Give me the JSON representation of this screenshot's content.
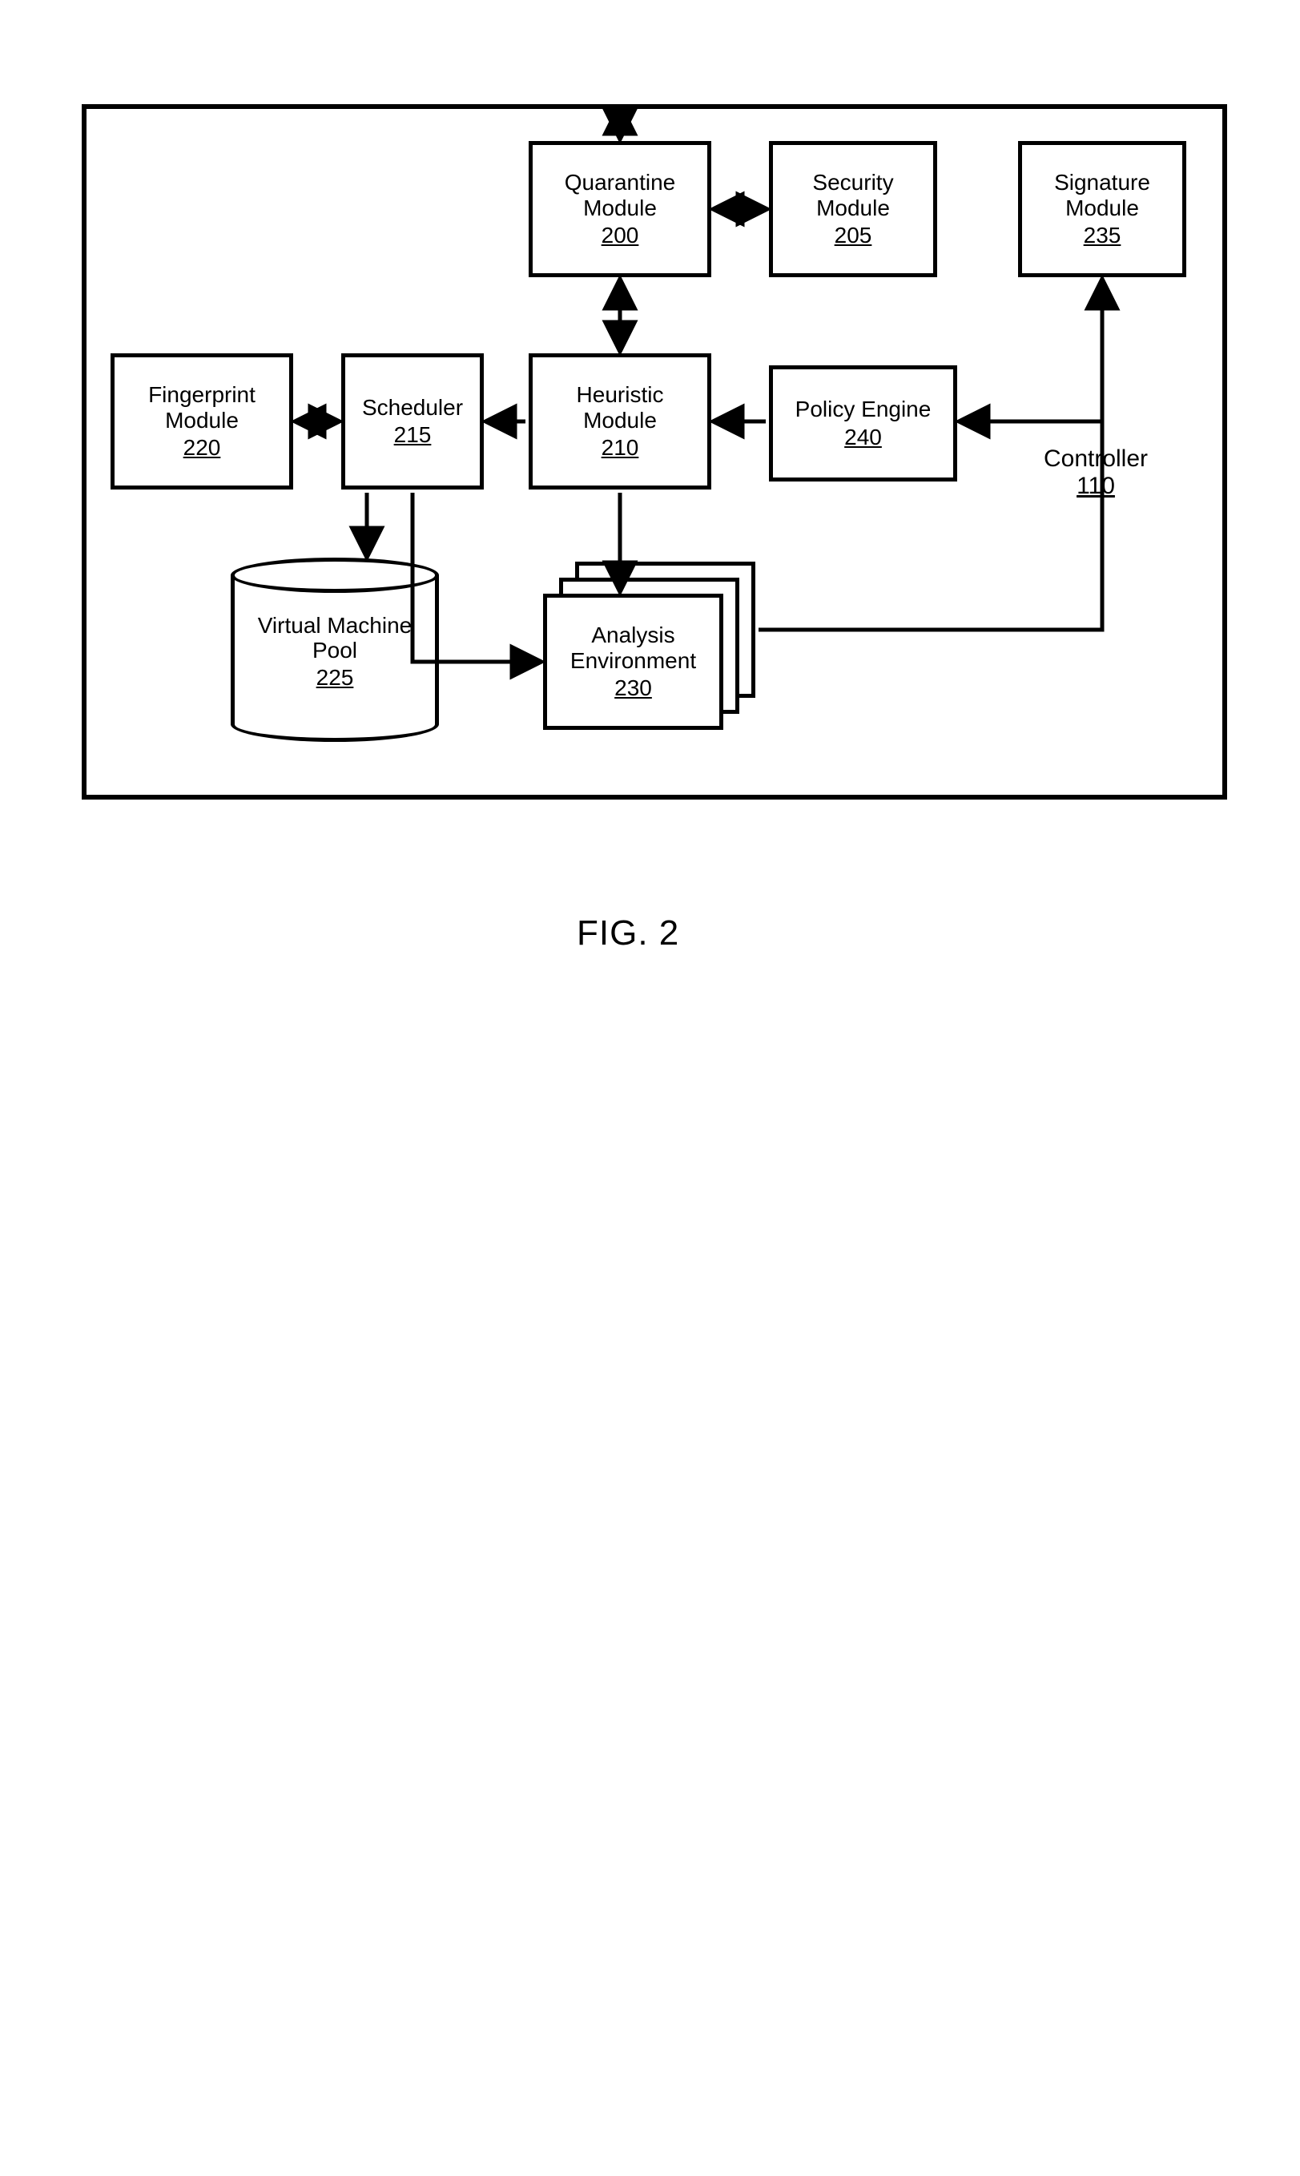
{
  "figure_caption": "FIG. 2",
  "controller": {
    "name": "Controller",
    "ref": "110"
  },
  "boxes": {
    "quarantine": {
      "name": "Quarantine\nModule",
      "ref": "200"
    },
    "security": {
      "name": "Security\nModule",
      "ref": "205"
    },
    "heuristic": {
      "name": "Heuristic\nModule",
      "ref": "210"
    },
    "policy": {
      "name": "Policy Engine",
      "ref": "240"
    },
    "signature": {
      "name": "Signature\nModule",
      "ref": "235"
    },
    "scheduler": {
      "name": "Scheduler",
      "ref": "215"
    },
    "fingerprint": {
      "name": "Fingerprint\nModule",
      "ref": "220"
    },
    "analysis": {
      "name": "Analysis\nEnvironment",
      "ref": "230"
    },
    "vmpool": {
      "name": "Virtual Machine\nPool",
      "ref": "225"
    }
  }
}
